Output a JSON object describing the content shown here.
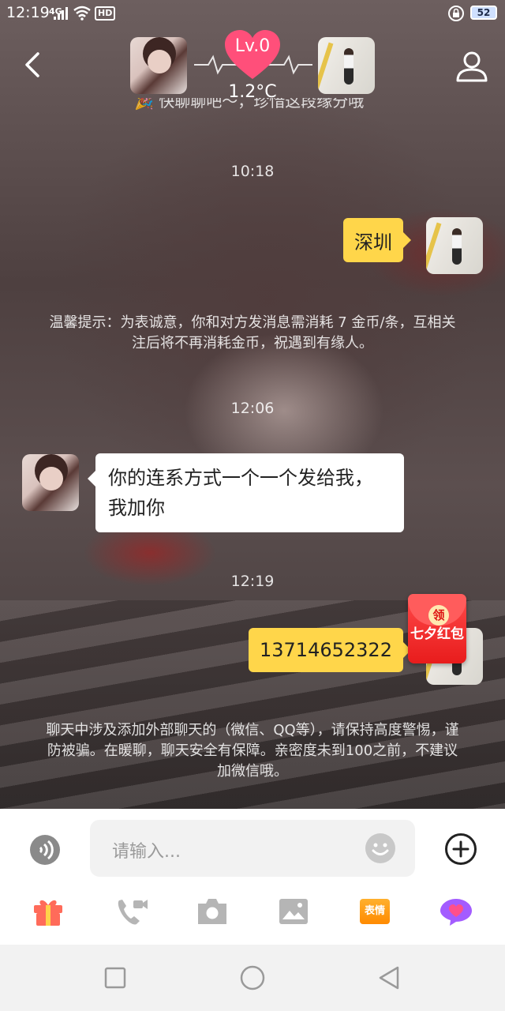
{
  "status_bar": {
    "time": "12:19",
    "signal": "4G",
    "network_badge": "HD",
    "battery": "52"
  },
  "header": {
    "level_label": "Lv.0",
    "temperature": "1.2°C",
    "partial_notice": "🎉 快聊聊吧～，珍惜这段缘分哦"
  },
  "messages": [
    {
      "type": "time",
      "text": "10:18"
    },
    {
      "type": "outgoing",
      "text": "深圳"
    },
    {
      "type": "notice",
      "text": "温馨提示：为表诚意，你和对方发消息需消耗 7 金币/条，互相关注后将不再消耗金币，祝遇到有缘人。"
    },
    {
      "type": "time",
      "text": "12:06"
    },
    {
      "type": "incoming",
      "text": "你的连系方式一个一个发给我，我加你"
    },
    {
      "type": "time",
      "text": "12:19"
    },
    {
      "type": "outgoing",
      "text": "13714652322"
    },
    {
      "type": "notice",
      "text": "聊天中涉及添加外部聊天的（微信、QQ等），请保持高度警惕，谨防被骗。在暖聊，聊天安全有保障。亲密度未到100之前，不建议加微信哦。"
    }
  ],
  "red_packet": {
    "badge": "领",
    "label": "七夕红包",
    "color": "#e81c1c"
  },
  "input": {
    "placeholder": "请输入..."
  },
  "toolbar": {
    "items": [
      "gift-icon",
      "video-call-icon",
      "camera-icon",
      "image-icon",
      "emoji-sticker-icon",
      "chat-heart-icon"
    ],
    "sticker_label": "表情"
  },
  "colors": {
    "outgoing_bubble": "#ffd64a",
    "incoming_bubble": "#ffffff",
    "level_heart": "#ff4f7a"
  }
}
